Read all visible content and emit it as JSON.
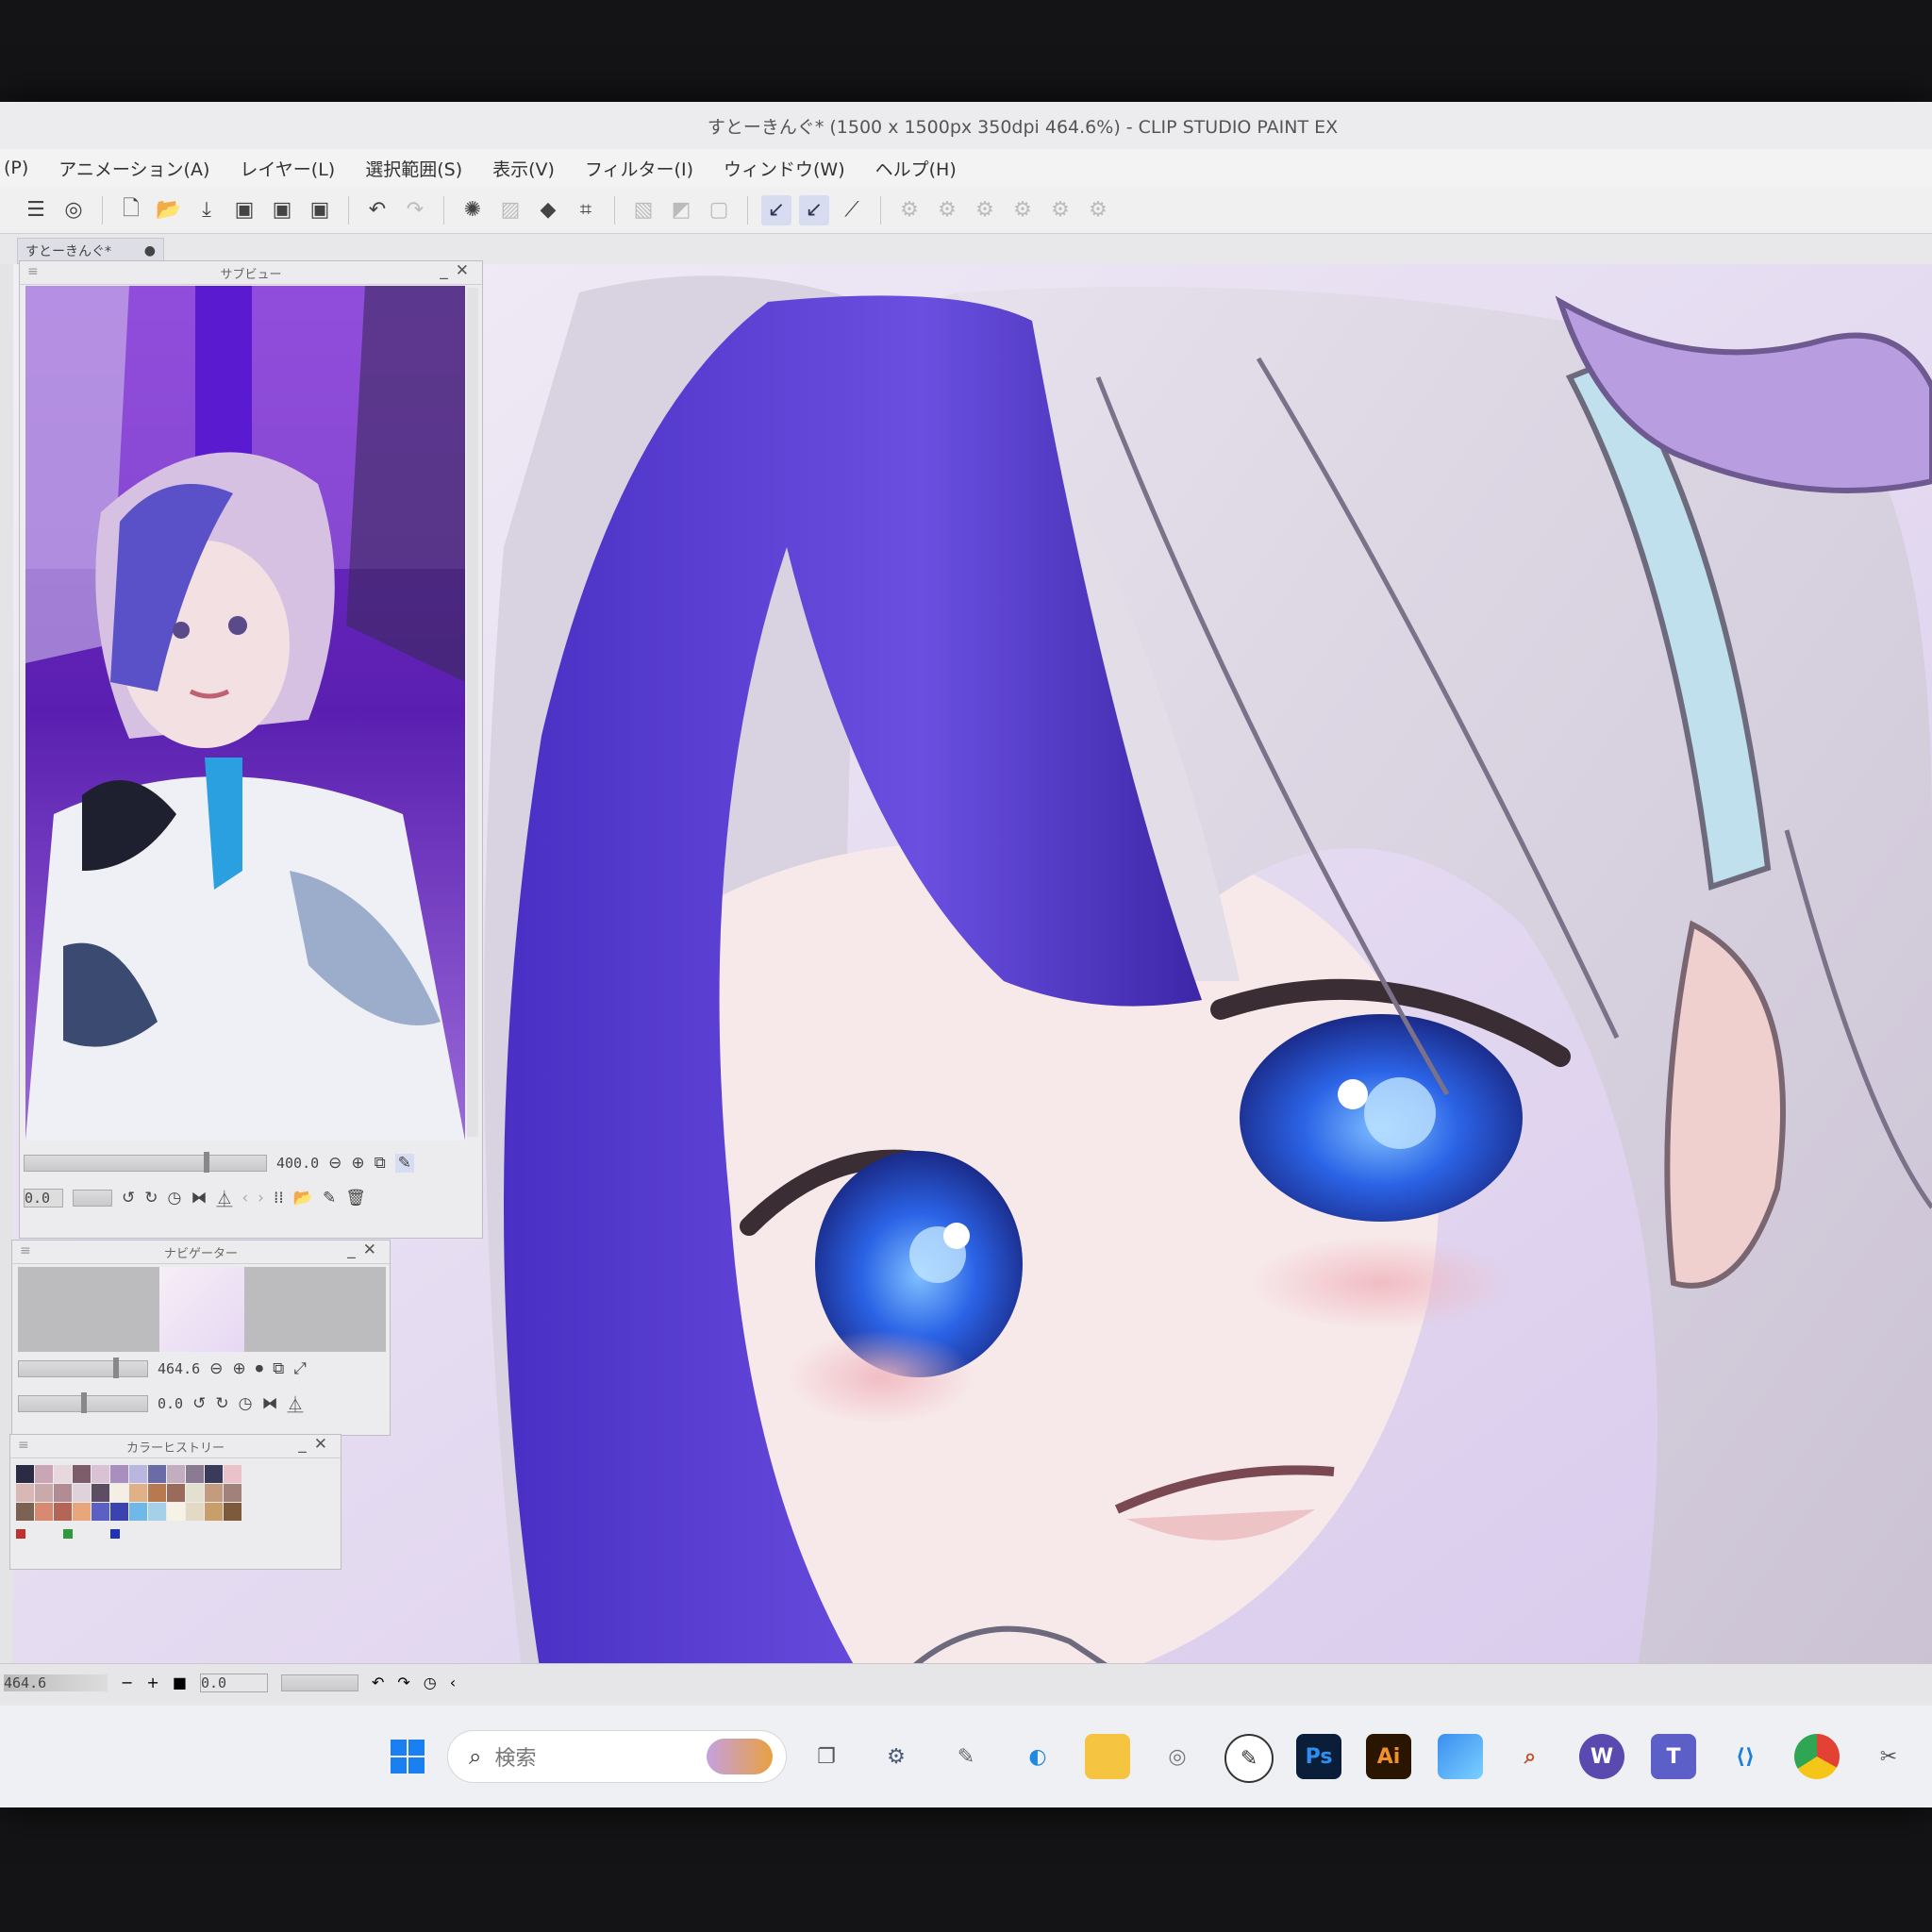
{
  "window": {
    "title": "すとーきんぐ* (1500 x 1500px 350dpi 464.6%) - CLIP STUDIO PAINT EX"
  },
  "menu": [
    {
      "label": "(P)"
    },
    {
      "label": "アニメーション(A)"
    },
    {
      "label": "レイヤー(L)"
    },
    {
      "label": "選択範囲(S)"
    },
    {
      "label": "表示(V)"
    },
    {
      "label": "フィルター(I)"
    },
    {
      "label": "ウィンドウ(W)"
    },
    {
      "label": "ヘルプ(H)"
    }
  ],
  "document_tab": {
    "label": "すとーきんぐ*",
    "modified_mark": "●"
  },
  "subview": {
    "title": "サブビュー",
    "zoom_value": "400.0",
    "rotate_value": "0.0"
  },
  "navigator": {
    "title": "ナビゲーター",
    "zoom_value": "464.6",
    "rotate_value": "0.0"
  },
  "color_history": {
    "title": "カラーヒストリー",
    "swatches": [
      "#2b2c44",
      "#c9a6b5",
      "#e8d7dc",
      "#7e5d6a",
      "#d9c2d4",
      "#a98fbf",
      "#b9b7e0",
      "#6b6ba8",
      "#c3adc0",
      "#8a7a92",
      "#3a3a5a",
      "#e9c3c9",
      "#d8b7b4",
      "#c9a9aa",
      "#b28c95",
      "#e0d2da",
      "#5d4d62",
      "#f3efe4",
      "#e0b089",
      "#b87850",
      "#9a6a5a",
      "#e3e0cf",
      "#c59b7f",
      "#a0827a",
      "#7b6252",
      "#d78a70",
      "#b46555",
      "#e9a57c",
      "#5c5fc4",
      "#3a43b0",
      "#6fb8e8",
      "#a4d0ea",
      "#f7f2e6",
      "#e4d9c4",
      "#c89f6a",
      "#7e5a3c"
    ],
    "mini": [
      "#c0302c",
      "#2c9a3a",
      "#2033b8"
    ]
  },
  "statusbar": {
    "zoom": "464.6",
    "rotate": "0.0"
  },
  "taskbar": {
    "search_placeholder": "検索",
    "apps": [
      {
        "name": "windows-start",
        "label": ""
      },
      {
        "name": "task-view",
        "label": ""
      },
      {
        "name": "settings",
        "label": ""
      },
      {
        "name": "pen-app",
        "label": ""
      },
      {
        "name": "edge",
        "label": ""
      },
      {
        "name": "file-explorer",
        "label": ""
      },
      {
        "name": "clip-studio",
        "label": ""
      },
      {
        "name": "clip-studio-paint",
        "label": ""
      },
      {
        "name": "photoshop",
        "label": "Ps"
      },
      {
        "name": "illustrator",
        "label": "Ai"
      },
      {
        "name": "photos",
        "label": ""
      },
      {
        "name": "screenshot",
        "label": ""
      },
      {
        "name": "wacom",
        "label": "W"
      },
      {
        "name": "teams",
        "label": ""
      },
      {
        "name": "vscode",
        "label": ""
      },
      {
        "name": "chrome",
        "label": ""
      },
      {
        "name": "snipping-tool",
        "label": ""
      }
    ]
  },
  "colors": {
    "hair_purple": "#5a3fd0",
    "hair_silver": "#d9d2df",
    "eye_blue": "#2c62e0",
    "skin": "#f6e6e6"
  }
}
